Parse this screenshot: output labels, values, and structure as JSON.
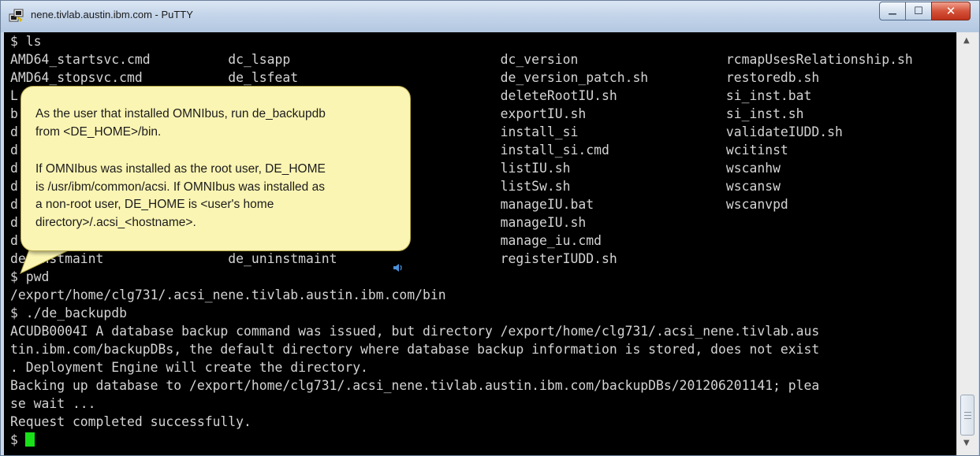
{
  "window": {
    "title": "nene.tivlab.austin.ibm.com - PuTTY",
    "controls": {
      "minimize": "—",
      "maximize": "☐",
      "close": "✕"
    }
  },
  "colors": {
    "terminal_bg": "#000000",
    "terminal_text": "#d4d4d4",
    "cursor": "#19e019",
    "callout_bg": "#fbf5b3",
    "close_button": "#c0311b"
  },
  "terminal": {
    "lines": [
      "$ ls",
      "AMD64_startsvc.cmd          dc_lsapp                           dc_version                   rcmapUsesRelationship.sh",
      "AMD64_stopsvc.cmd           de_lsfeat                          de_version_patch.sh          restoredb.sh",
      "L                                                              deleteRootIU.sh              si_inst.bat",
      "b                                                              exportIU.sh                  si_inst.sh",
      "d                                                              install_si                   validateIUDD.sh",
      "d                                                              install_si.cmd               wcitinst",
      "d                                                              listIU.sh                    wscanhw",
      "d                                                              listSw.sh                    wscansw",
      "d                                                              manageIU.bat                 wscanvpd",
      "d                                                              manageIU.sh",
      "d                                                              manage_iu.cmd",
      "de_instmaint                de_uninstmaint                     registerIUDD.sh",
      "$ pwd",
      "/export/home/clg731/.acsi_nene.tivlab.austin.ibm.com/bin",
      "$ ./de_backupdb",
      "ACUDB0004I A database backup command was issued, but directory /export/home/clg731/.acsi_nene.tivlab.aus",
      "tin.ibm.com/backupDBs, the default directory where database backup information is stored, does not exist",
      ". Deployment Engine will create the directory.",
      "Backing up database to /export/home/clg731/.acsi_nene.tivlab.austin.ibm.com/backupDBs/201206201141; plea",
      "se wait ...",
      "Request completed successfully.",
      "$"
    ]
  },
  "callout": {
    "paragraph1": [
      "As the user that installed OMNIbus, run de_backupdb",
      "from <DE_HOME>/bin."
    ],
    "paragraph2": [
      "If OMNIbus was installed as the root user, DE_HOME",
      "is /usr/ibm/common/acsi. If OMNIbus was installed as",
      "a non-root user, DE_HOME is <user's home",
      "directory>/.acsi_<hostname>."
    ]
  },
  "scrollbar": {
    "up_arrow": "▲",
    "down_arrow": "▼"
  },
  "icons": {
    "app": "putty-icon",
    "audio": "speaker-icon"
  }
}
